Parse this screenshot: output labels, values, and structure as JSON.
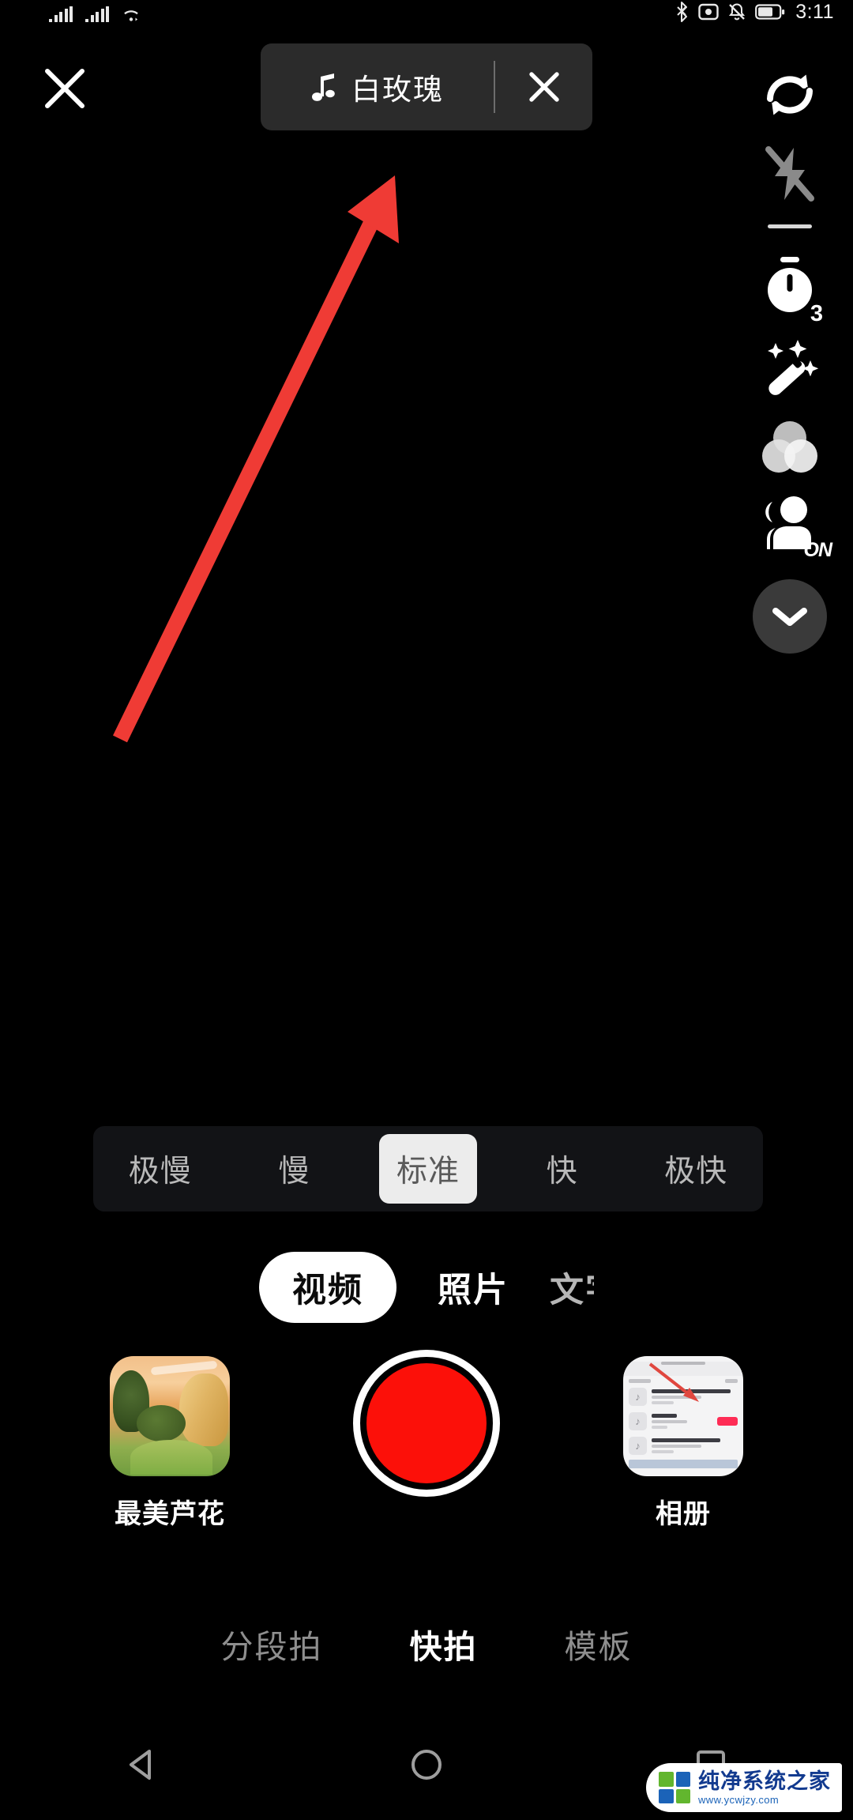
{
  "status_bar": {
    "time": "3:11",
    "icons_left": [
      "signal-bars-sim1",
      "signal-bars-sim2",
      "wifi-icon"
    ],
    "icons_right": [
      "bluetooth-icon",
      "screenshot-icon",
      "notifications-muted-icon",
      "battery-icon"
    ]
  },
  "top_bar": {
    "close_label": "✕",
    "music": {
      "note_icon": "music-note-icon",
      "title": "白玫瑰",
      "remove_label": "✕"
    }
  },
  "right_rail": {
    "items": [
      {
        "icon": "flip-camera-icon",
        "label": "翻转"
      },
      {
        "icon": "flash-off-icon",
        "label": "闪光灯"
      },
      {
        "icon": "timer-icon",
        "label": "倒计时",
        "badge": "3"
      },
      {
        "icon": "beauty-wand-icon",
        "label": "美化"
      },
      {
        "icon": "filters-icon",
        "label": "滤镜"
      },
      {
        "icon": "portrait-mode-icon",
        "label": "人像",
        "badge": "ON"
      },
      {
        "icon": "chevron-down-icon",
        "label": "展开"
      }
    ]
  },
  "annotation": {
    "arrow_color": "#ef3b35",
    "points_to": "music-pill"
  },
  "speed_bar": {
    "options": [
      {
        "label": "极慢",
        "selected": false
      },
      {
        "label": "慢",
        "selected": false
      },
      {
        "label": "标准",
        "selected": true
      },
      {
        "label": "快",
        "selected": false
      },
      {
        "label": "极快",
        "selected": false
      }
    ]
  },
  "mode_tabs": {
    "items": [
      {
        "label": "视频",
        "selected": true
      },
      {
        "label": "照片",
        "selected": false
      },
      {
        "label": "文字",
        "selected": false,
        "clipped": true
      }
    ]
  },
  "capture_row": {
    "effect": {
      "thumb": "reed-landscape-thumbnail",
      "label": "最美芦花"
    },
    "record": {
      "icon": "record-button",
      "color": "#fc1009"
    },
    "album": {
      "thumb": "album-screenshot-thumbnail",
      "label": "相册"
    }
  },
  "bottom_modes": {
    "items": [
      {
        "label": "分段拍",
        "active": false
      },
      {
        "label": "快拍",
        "active": true
      },
      {
        "label": "模板",
        "active": false
      }
    ]
  },
  "nav_bar": {
    "back": "back-triangle-icon",
    "home": "home-circle-icon",
    "recents": "recents-square-icon"
  },
  "watermark": {
    "title": "纯净系统之家",
    "url": "www.ycwjzy.com",
    "colors": [
      "#62b62e",
      "#1b63b8",
      "#1b63b8",
      "#62b62e"
    ]
  }
}
